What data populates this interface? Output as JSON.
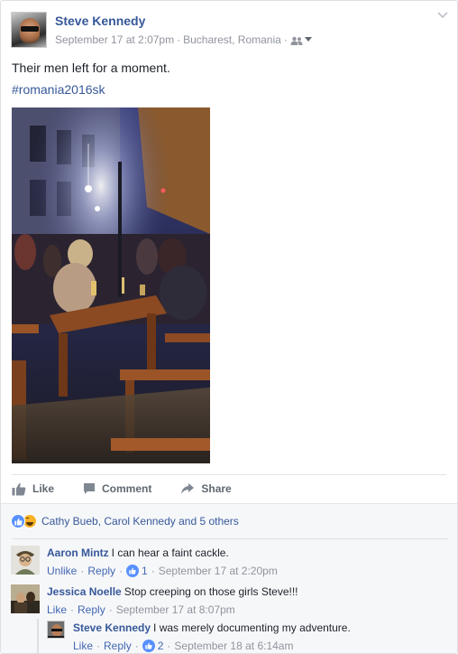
{
  "post": {
    "author": "Steve Kennedy",
    "date": "September 17 at 2:07pm",
    "location": "Bucharest, Romania",
    "dot": "·",
    "text": "Their men left for a moment.",
    "hashtag": "#romania2016sk",
    "audience_icon": "friends-icon",
    "menu_icon": "chevron-down-icon"
  },
  "actions": {
    "like": "Like",
    "comment": "Comment",
    "share": "Share"
  },
  "reactions": {
    "summary": "Cathy Bueb, Carol Kennedy and 5 others"
  },
  "comments": [
    {
      "name": "Aaron Mintz",
      "text": "I can hear a faint cackle.",
      "action1": "Unlike",
      "action2": "Reply",
      "likes": "1",
      "time": "September 17 at 2:20pm"
    },
    {
      "name": "Jessica Noelle",
      "text": "Stop creeping on those girls Steve!!!",
      "action1": "Like",
      "action2": "Reply",
      "time": "September 17 at 8:07pm"
    },
    {
      "name": "Steve Kennedy",
      "text": "I was merely documenting my adventure.",
      "action1": "Like",
      "action2": "Reply",
      "likes": "2",
      "time": "September 18 at 6:14am"
    }
  ],
  "colors": {
    "link": "#365899",
    "action_link": "#4267b2",
    "meta": "#90949c",
    "like_blue": "#5890ff",
    "haha_yellow": "#f7b125"
  }
}
